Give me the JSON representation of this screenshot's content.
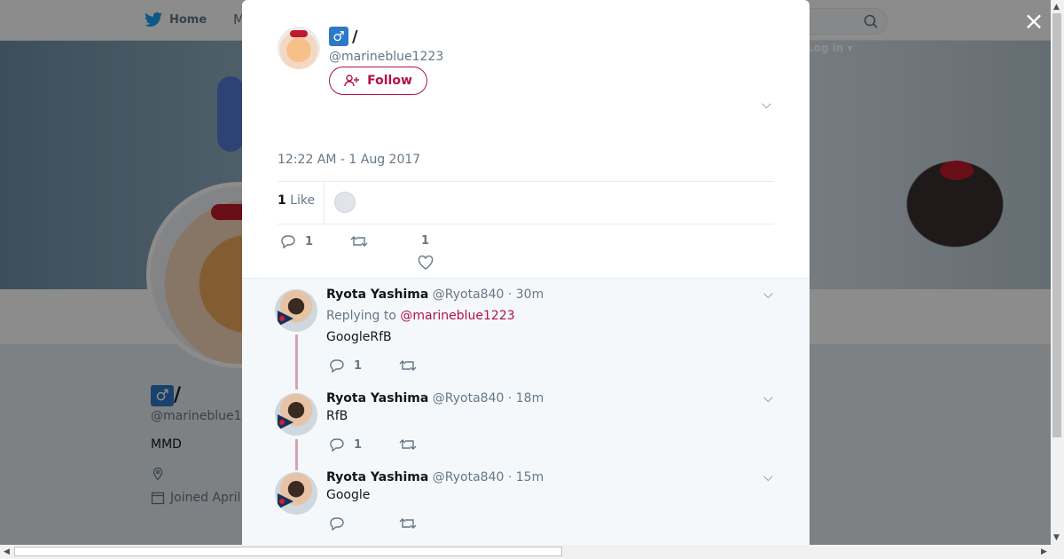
{
  "nav": {
    "home_label": "Home",
    "moments_label": "M",
    "login_label": "Log in ▾"
  },
  "profile": {
    "name": "♂/ ",
    "name_prefix": "",
    "name_icon": "♂",
    "name_suffix": "/ ",
    "handle": "@marineblue1",
    "bio": "MMD",
    "joined": "Joined April"
  },
  "tweet": {
    "name_icon": "♂",
    "name_suffix": "/",
    "handle": "@marineblue1223",
    "follow_label": "Follow",
    "text": "",
    "timestamp": "12:22 AM - 1 Aug 2017",
    "like_count": "1",
    "like_label": "Like",
    "reply_count": "1",
    "favorite_count": "1"
  },
  "replies": [
    {
      "name": "Ryota Yashima",
      "handle": "@Ryota840",
      "time": "· 30m",
      "replying_to_label": "Replying to",
      "replying_to": "@marineblue1223",
      "text": "GoogleRfB",
      "reply_count": "1"
    },
    {
      "name": "Ryota Yashima",
      "handle": "@Ryota840",
      "time": "· 18m",
      "text": "RfB",
      "reply_count": "1"
    },
    {
      "name": "Ryota Yashima",
      "handle": "@Ryota840",
      "time": "· 15m",
      "text": "Google",
      "reply_count": ""
    }
  ],
  "icons": {
    "close": "×",
    "caret": "⌵"
  },
  "colors": {
    "accent": "#b1114e",
    "twitter_blue": "#1da1f2",
    "muted": "#657786"
  }
}
